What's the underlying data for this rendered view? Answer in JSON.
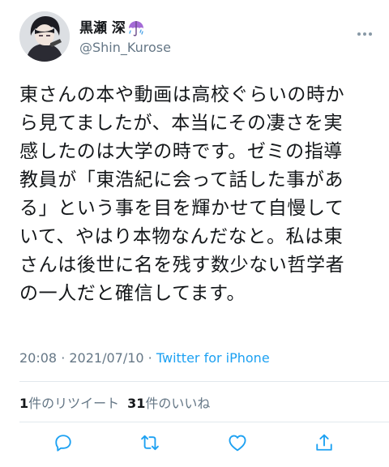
{
  "user": {
    "display_name": "黒瀬 深",
    "handle": "@Shin_Kurose",
    "name_emoji_icon": "umbrella-with-rain-icon",
    "avatar_icon": "anime-character-avatar"
  },
  "tweet": {
    "lines": [
      "東さんの本や動画は高校ぐらいの時か",
      "ら見てましたが、本当にその凄さを実",
      "感したのは大学の時です。ゼミの指導",
      "教員が「東浩紀に会って話した事があ",
      "る」という事を目を輝かせて自慢して",
      "いて、やはり本物なんだなと。私は東",
      "さんは後世に名を残す数少ない哲学者",
      "の一人だと確信してます。"
    ]
  },
  "meta": {
    "time": "20:08",
    "separator1": " · ",
    "date": "2021/07/10",
    "separator2": " · ",
    "source": "Twitter for iPhone"
  },
  "stats": {
    "retweets_count": "1",
    "retweets_label": "件のリツイート",
    "likes_count": "31",
    "likes_label": "件のいいね"
  },
  "actions": [
    "reply-icon",
    "retweet-icon",
    "like-icon",
    "share-icon"
  ],
  "colors": {
    "text": "#14171a",
    "secondary": "#657786",
    "link": "#1da1f2",
    "divider": "#e1e8ed"
  }
}
